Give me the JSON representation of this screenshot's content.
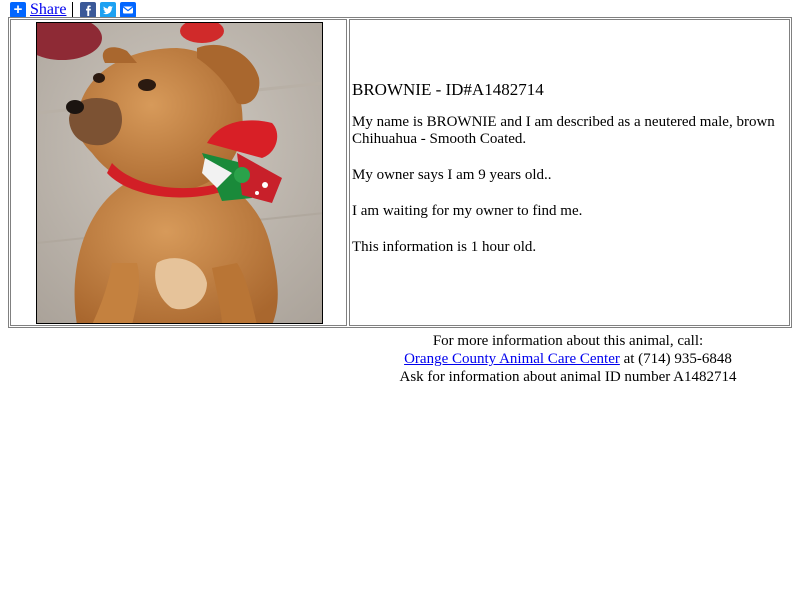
{
  "share": {
    "label": "Share",
    "icons": [
      "plus-icon",
      "facebook-icon",
      "twitter-icon",
      "email-icon"
    ]
  },
  "animal": {
    "title": "BROWNIE - ID#A1482714",
    "description": "My name is BROWNIE and I am described as a neutered male, brown Chihuahua - Smooth Coated.",
    "age_text": "My owner says I am 9 years old..",
    "status_text": "I am waiting for my owner to find me.",
    "info_age": "This information is 1 hour old."
  },
  "footer": {
    "line1": "For more information about this animal, call:",
    "center_link": "Orange County Animal Care Center",
    "phone_text": " at (714) 935-6848",
    "line3": "Ask for information about animal ID number A1482714"
  },
  "colors": {
    "link": "#0000ee",
    "share_blue": "#0166ff",
    "facebook": "#3b5998",
    "twitter": "#1da1f2"
  }
}
